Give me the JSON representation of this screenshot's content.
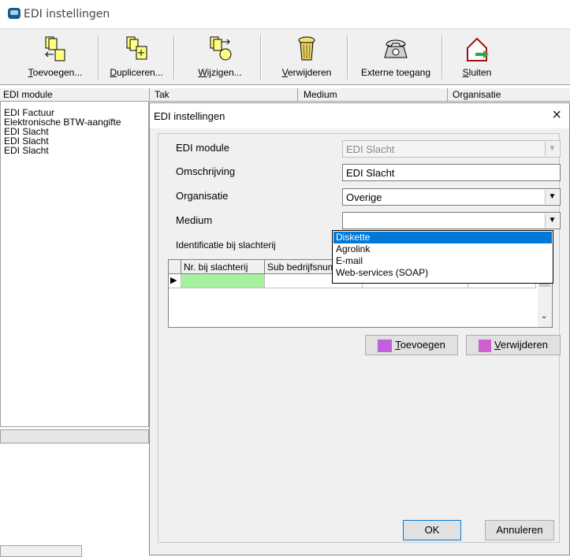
{
  "window": {
    "title": "EDI instellingen"
  },
  "toolbar": {
    "buttons": [
      {
        "label": "Toevoegen...",
        "underline": "T",
        "rest": "oevoegen..."
      },
      {
        "label": "Dupliceren...",
        "underline": "D",
        "rest": "upliceren..."
      },
      {
        "label": "Wijzigen...",
        "underline": "W",
        "rest": "ijzigen..."
      },
      {
        "label": "Verwijderen",
        "underline": "V",
        "rest": "erwijderen"
      },
      {
        "label": "Externe toegang",
        "underline": "",
        "rest": "Externe toegang"
      },
      {
        "label": "Sluiten",
        "underline": "S",
        "rest": "luiten"
      }
    ]
  },
  "list": {
    "columns": [
      "EDI module",
      "Tak",
      "Medium",
      "Organisatie"
    ],
    "rows": [
      "EDI Factuur",
      "Elektronische BTW-aangifte",
      "EDI Slacht",
      "EDI Slacht",
      "EDI Slacht"
    ]
  },
  "dialog": {
    "title": "EDI instellingen",
    "close": "×",
    "fields": {
      "module_label": "EDI module",
      "module_value": "EDI Slacht",
      "omschrijving_label": "Omschrijving",
      "omschrijving_value": "EDI Slacht",
      "organisatie_label": "Organisatie",
      "organisatie_value": "Overige",
      "medium_label": "Medium",
      "medium_value": "",
      "identificatie_label": "Identificatie bij slachterij"
    },
    "grid": {
      "headers": [
        "Nr. bij slachterij",
        "Sub bedrijfsnummer"
      ],
      "row_indicator": "▶"
    },
    "medium_options": [
      "Diskette",
      "Agrolink",
      "E-mail",
      "Web-services (SOAP)"
    ],
    "medium_selected_option": "Diskette",
    "buttons": {
      "add": {
        "u": "T",
        "rest": "oevoegen"
      },
      "remove": {
        "u": "V",
        "rest": "erwijderen"
      },
      "ok": "OK",
      "cancel": "Annuleren"
    }
  },
  "colors": {
    "selection": "#0078d7",
    "grid_active_cell": "#a6f0a0",
    "accent_green": "#2eaa3a"
  }
}
